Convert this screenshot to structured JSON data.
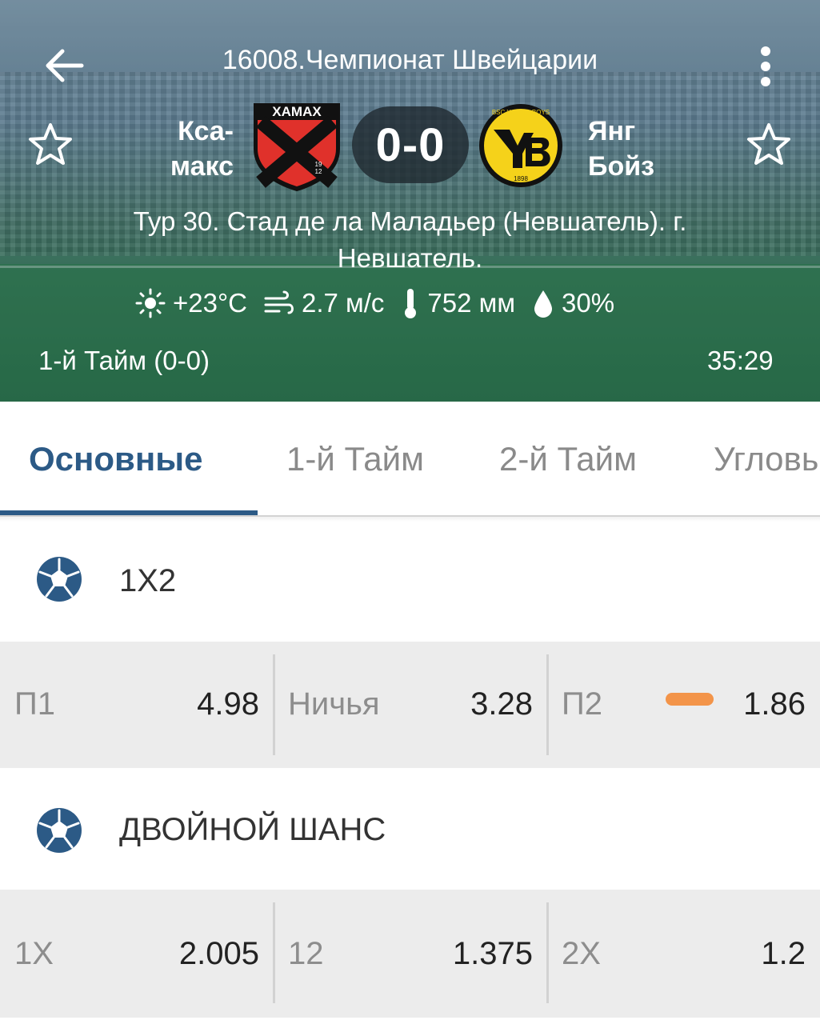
{
  "header": {
    "title": "16008.Чемпионат Швейцарии",
    "team1": {
      "name_line1": "Кса-",
      "name_line2": "макс",
      "logo_text": "XAMAX",
      "logo_year_a": "19",
      "logo_year_b": "12"
    },
    "team2": {
      "name_line1": "Янг",
      "name_line2": "Бойз",
      "logo_ring_text": "BSC YOUNG BOYS",
      "logo_year": "1898"
    },
    "score": "0-0",
    "venue": "Тур 30. Стад де ла Маладьер (Невшатель). г. Невшатель.",
    "weather": {
      "temperature": "+23°C",
      "wind": "2.7 м/с",
      "pressure": "752 мм",
      "humidity": "30%"
    },
    "period": "1-й  Тайм (0-0)",
    "timer": "35:29"
  },
  "tabs": [
    {
      "label": "Основные",
      "active": true
    },
    {
      "label": "1-й  Тайм",
      "active": false
    },
    {
      "label": "2-й  Тайм",
      "active": false
    },
    {
      "label": "Угловые",
      "active": false
    }
  ],
  "markets": [
    {
      "title": "1X2",
      "odds": [
        {
          "label": "П1",
          "value": "4.98"
        },
        {
          "label": "Ничья",
          "value": "3.28"
        },
        {
          "label": "П2",
          "value": "1.86"
        }
      ]
    },
    {
      "title": "ДВОЙНОЙ ШАНС",
      "odds": [
        {
          "label": "1X",
          "value": "2.005"
        },
        {
          "label": "12",
          "value": "1.375"
        },
        {
          "label": "2X",
          "value": "1.2"
        }
      ]
    }
  ],
  "colors": {
    "accent": "#2c5a86",
    "odds_change_marker": "#f39449",
    "xamax_red": "#e0312b",
    "yb_yellow": "#f5d21a"
  }
}
